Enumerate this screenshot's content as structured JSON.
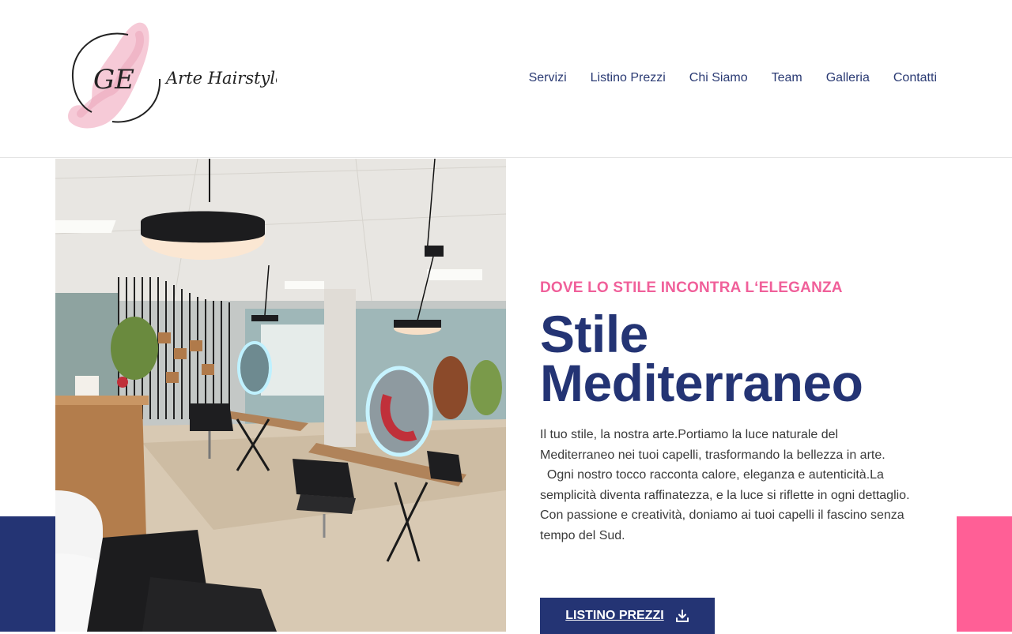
{
  "brand": {
    "monogram": "GE",
    "name": "Arte Hairstyle"
  },
  "nav": {
    "items": [
      "Servizi",
      "Listino Prezzi",
      "Chi Siamo",
      "Team",
      "Galleria",
      "Contatti"
    ]
  },
  "hero": {
    "eyebrow": "DOVE LO STILE INCONTRA L‘ELEGANZA",
    "title_line1": "Stile",
    "title_line2": "Mediterraneo",
    "paragraphs": [
      "Il tuo stile, la nostra arte.Portiamo la luce naturale del Mediterraneo nei tuoi capelli, trasformando la bellezza in arte.",
      "  Ogni nostro tocco racconta calore, eleganza e autenticità.La semplicità diventa raffinatezza, e la luce si riflette in ogni dettaglio.",
      "Con passione e creatività, doniamo ai tuoi capelli il fascino senza tempo del Sud."
    ],
    "button_label": "LISTINO PREZZI",
    "button_icon": "download-icon",
    "photo_alt": "salon interior with mirrors, chairs and pendant lamps"
  },
  "colors": {
    "navy": "#243474",
    "pink": "#ff5f96",
    "eyebrow": "#f0609a"
  }
}
